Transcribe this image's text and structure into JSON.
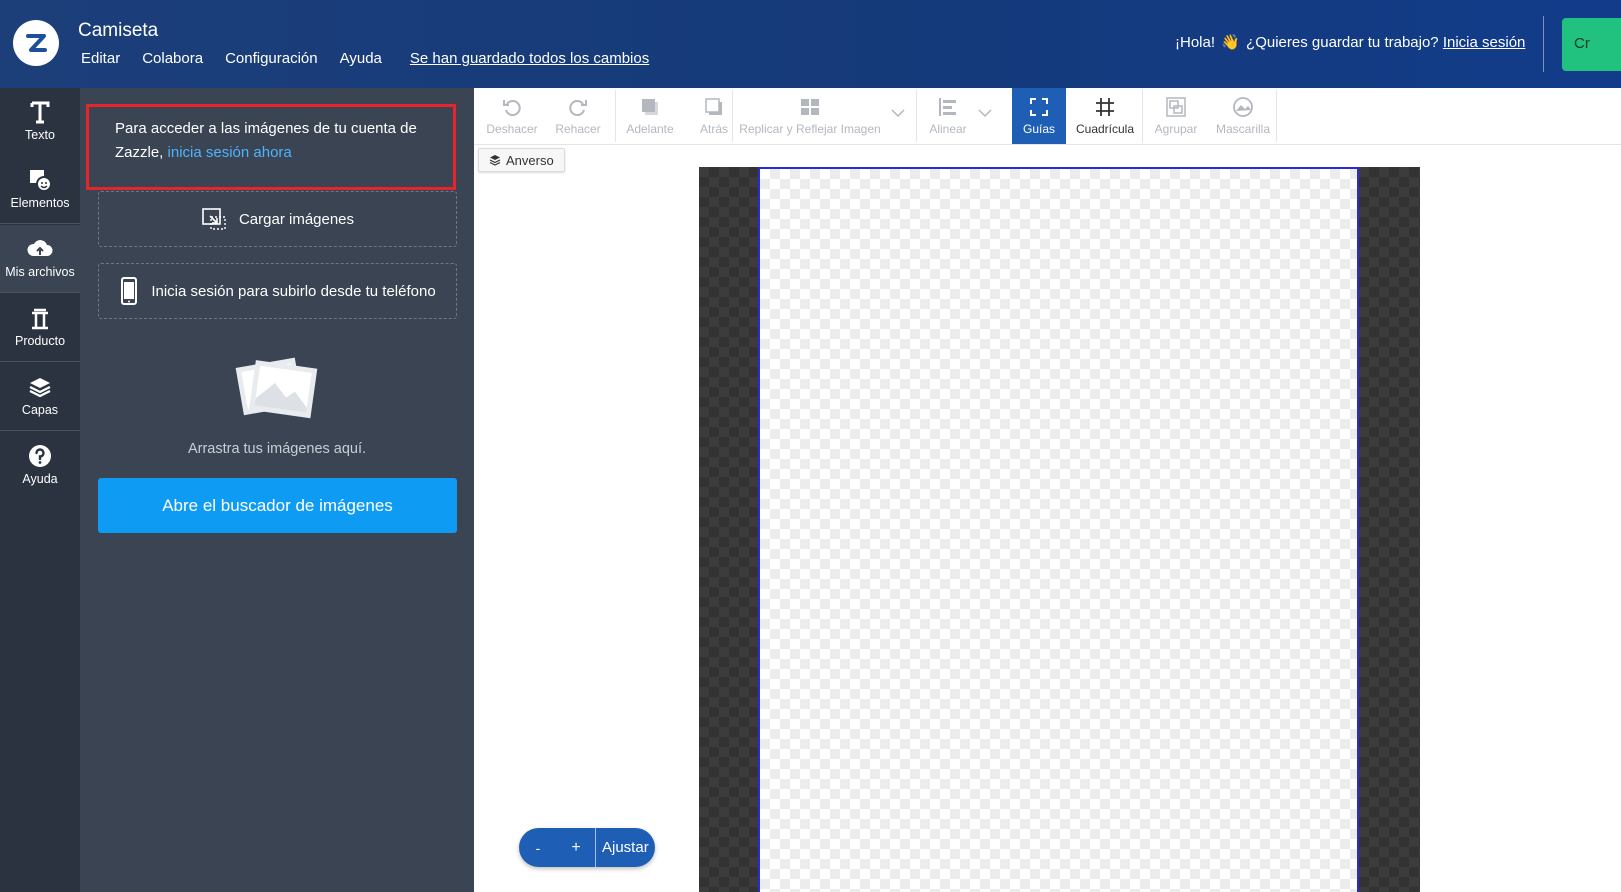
{
  "header": {
    "title": "Camiseta",
    "menu": [
      "Editar",
      "Colabora",
      "Configuración",
      "Ayuda"
    ],
    "saved_status": "Se han guardado todos los cambios",
    "greeting_prefix": "¡Hola!",
    "greeting_question": "¿Quieres guardar tu trabajo?",
    "login_link": "Inicia sesión",
    "cta_label": "Cr"
  },
  "rail": {
    "items": [
      {
        "label": "Texto",
        "icon": "text-icon"
      },
      {
        "label": "Elementos",
        "icon": "elements-icon"
      },
      {
        "label": "Mis archivos",
        "icon": "cloud-upload-icon"
      },
      {
        "label": "Producto",
        "icon": "product-icon"
      },
      {
        "label": "Capas",
        "icon": "layers-icon"
      },
      {
        "label": "Ayuda",
        "icon": "help-icon"
      }
    ]
  },
  "panel": {
    "notice_text": "Para acceder a las imágenes de tu cuenta de Zazzle,",
    "notice_link": "inicia sesión ahora",
    "upload_label": "Cargar imágenes",
    "phone_label": "Inicia sesión para subirlo desde tu teléfono",
    "drag_text": "Arrastra tus imágenes aquí.",
    "browse_button": "Abre el buscador de imágenes"
  },
  "toolbar": {
    "undo": "Deshacer",
    "redo": "Rehacer",
    "forward": "Adelante",
    "back": "Atrás",
    "replicate": "Replicar y Reflejar Imagen",
    "align": "Alinear",
    "guides": "Guías",
    "grid": "Cuadrícula",
    "group": "Agrupar",
    "mask": "Mascarilla"
  },
  "canvas": {
    "side_label": "Anverso"
  },
  "zoom": {
    "minus": "-",
    "plus": "+",
    "fit": "Ajustar"
  },
  "colors": {
    "header_bg": "#153a7a",
    "panel_bg": "#3a4452",
    "rail_bg": "#2b3340",
    "accent_blue": "#0e9bf4",
    "active_tool": "#1e5fb5",
    "cta_green": "#21c27f",
    "highlight_red": "#e5242b"
  }
}
